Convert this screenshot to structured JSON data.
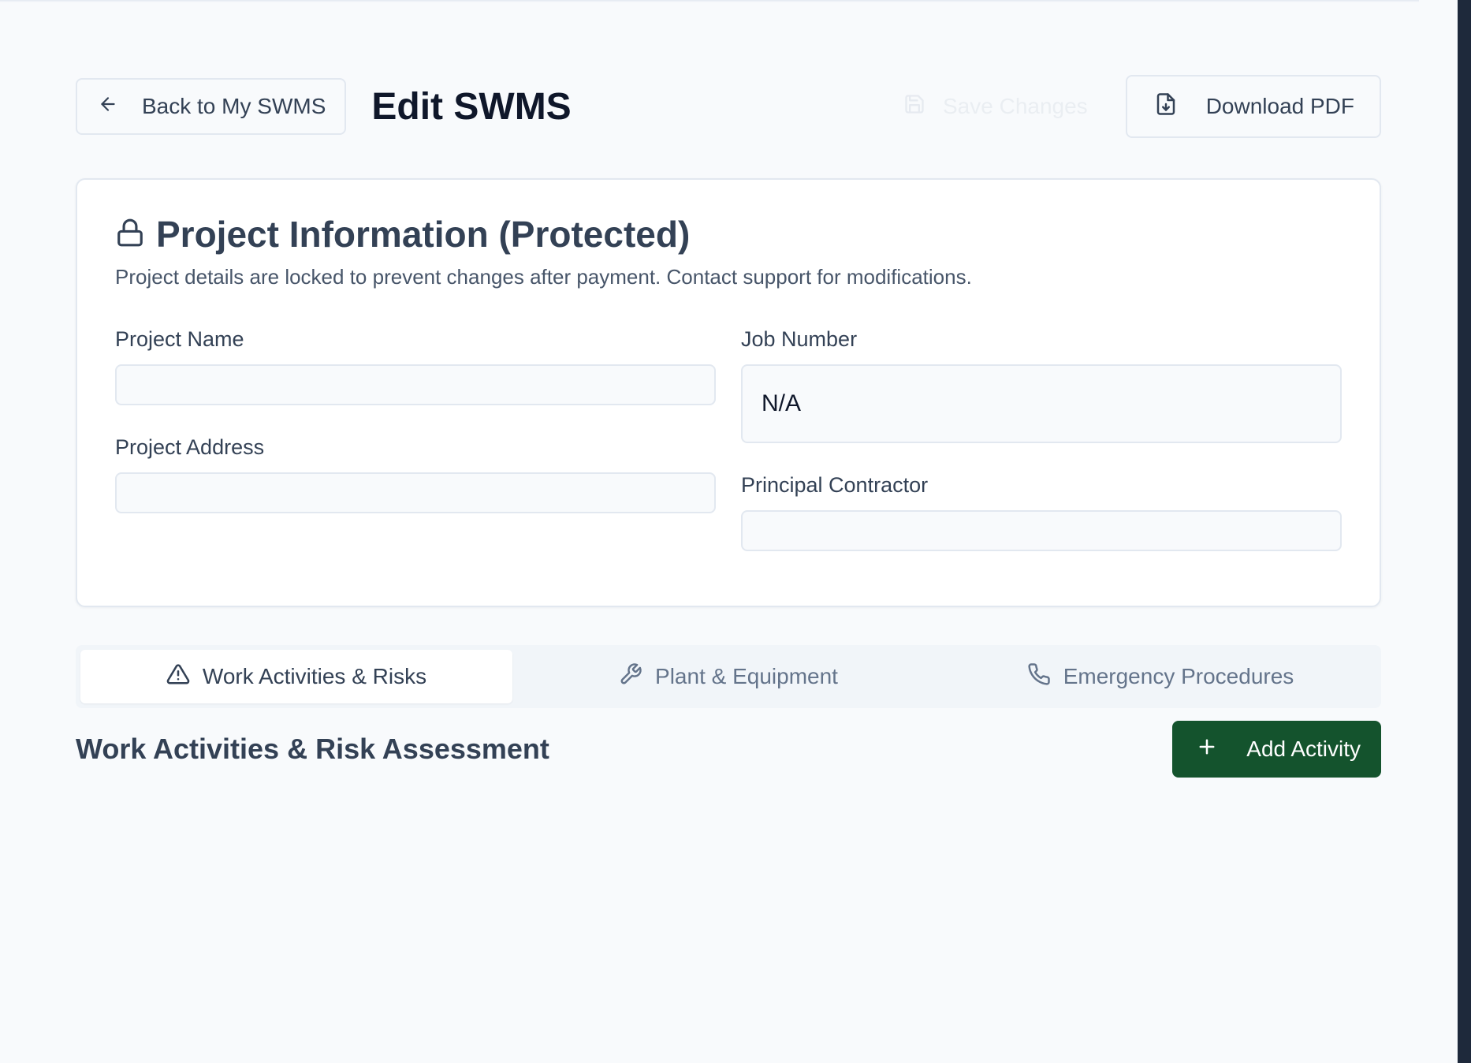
{
  "header": {
    "back_label": "Back to My SWMS",
    "title": "Edit SWMS",
    "save_label": "Save Changes",
    "download_label": "Download PDF"
  },
  "project_card": {
    "title": "Project Information (Protected)",
    "description": "Project details are locked to prevent changes after payment. Contact support for modifications.",
    "fields": {
      "project_name": {
        "label": "Project Name",
        "value": ""
      },
      "job_number": {
        "label": "Job Number",
        "value": "N/A"
      },
      "project_address": {
        "label": "Project Address",
        "value": ""
      },
      "principal_contractor": {
        "label": "Principal Contractor",
        "value": ""
      }
    }
  },
  "tabs": [
    {
      "label": "Work Activities & Risks",
      "icon": "alert-triangle-icon",
      "active": true
    },
    {
      "label": "Plant & Equipment",
      "icon": "wrench-icon",
      "active": false
    },
    {
      "label": "Emergency Procedures",
      "icon": "phone-icon",
      "active": false
    }
  ],
  "section": {
    "title": "Work Activities & Risk Assessment",
    "add_label": "Add Activity"
  },
  "colors": {
    "primary_button": "#14532d",
    "background": "#f8fafc",
    "text": "#334155"
  }
}
